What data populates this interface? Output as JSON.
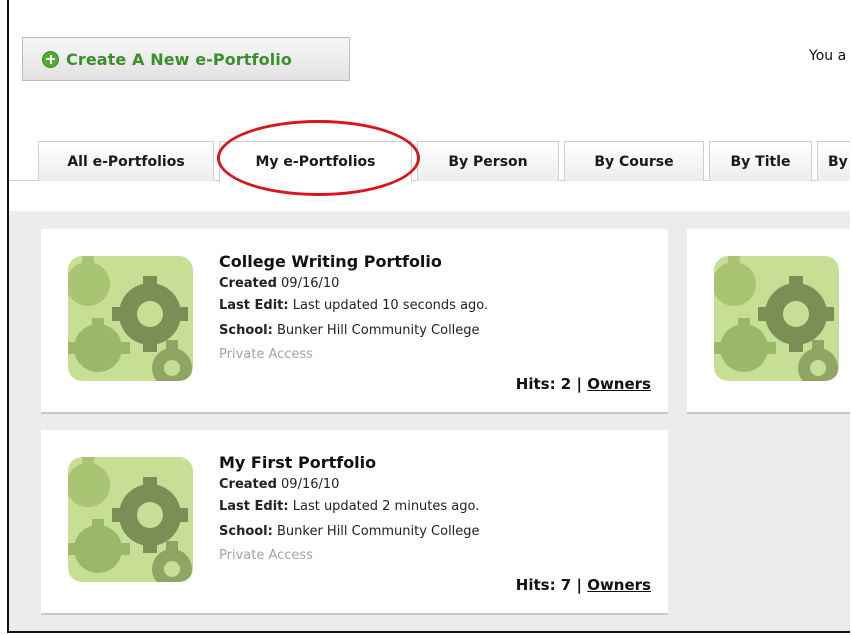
{
  "header": {
    "create_button_label": "Create A New e-Portfolio",
    "user_text": "You a"
  },
  "tabs": [
    {
      "label": "All e-Portfolios",
      "active": false
    },
    {
      "label": "My e-Portfolios",
      "active": true
    },
    {
      "label": "By Person",
      "active": false
    },
    {
      "label": "By Course",
      "active": false
    },
    {
      "label": "By Title",
      "active": false
    },
    {
      "label": "By",
      "active": false
    }
  ],
  "portfolios": [
    {
      "title": "College Writing Portfolio",
      "created_label": "Created",
      "created_value": "09/16/10",
      "last_edit_label": "Last Edit:",
      "last_edit_value": "Last updated 10 seconds ago.",
      "school_label": "School:",
      "school_value": "Bunker Hill Community College",
      "access": "Private Access",
      "hits_text": "Hits: 2",
      "separator": "|",
      "owners_label": "Owners"
    },
    {
      "title": "My First Portfolio",
      "created_label": "Created",
      "created_value": "09/16/10",
      "last_edit_label": "Last Edit:",
      "last_edit_value": "Last updated 2 minutes ago.",
      "school_label": "School:",
      "school_value": "Bunker Hill Community College",
      "access": "Private Access",
      "hits_text": "Hits: 7",
      "separator": "|",
      "owners_label": "Owners"
    }
  ],
  "colors": {
    "accent_green": "#3a8f2a",
    "highlight_red": "#d9141b",
    "content_bg": "#ececec"
  },
  "icons": {
    "create": "plus-circle-icon",
    "portfolio_thumb": "gears-icon"
  }
}
